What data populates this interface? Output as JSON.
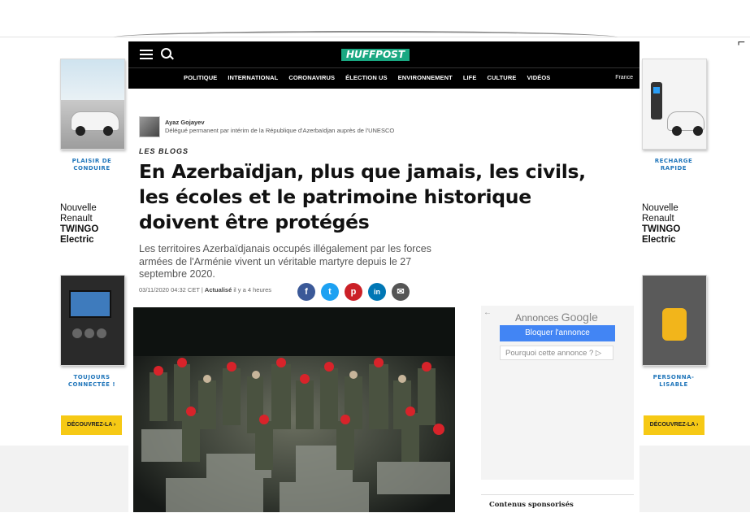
{
  "header": {
    "logo": "HUFFPOST",
    "nav": [
      "POLITIQUE",
      "INTERNATIONAL",
      "CORONAVIRUS",
      "ÉLECTION US",
      "ENVIRONNEMENT",
      "LIFE",
      "CULTURE",
      "VIDÉOS"
    ],
    "edition": "France"
  },
  "article": {
    "author_name": "Ayaz Gojayev",
    "author_role": "Délégué permanent par intérim de la République d'Azerbaïdjan auprès de l'UNESCO",
    "kicker": "LES BLOGS",
    "headline_lines": [
      "En Azerbaïdjan, plus que jamais, les civils,",
      "les écoles et le patrimoine historique",
      "doivent être protégés"
    ],
    "dek": "Les territoires Azerbaïdjanais occupés illégalement par les forces armées de l'Arménie vivent un véritable martyre depuis le 27 septembre 2020.",
    "date": "03/11/2020 04:32 CET",
    "updated_label": "Actualisé",
    "updated_rel": "il y a 4 heures"
  },
  "share": {
    "facebook": "f",
    "twitter": "t",
    "pinterest": "p",
    "linkedin": "in",
    "email": "✉"
  },
  "left_ad": {
    "caption_1": "PLAISIR DE CONDUIRE",
    "brand_1": "Nouvelle",
    "brand_2": "Renault",
    "model": "TWINGO",
    "model_2": "Electric",
    "caption_2": "TOUJOURS CONNECTÉE !",
    "cta": "DÉCOUVREZ-LA  ›"
  },
  "right_ad": {
    "caption_1": "RECHARGE RAPIDE",
    "brand_1": "Nouvelle",
    "brand_2": "Renault",
    "model": "TWINGO",
    "model_2": "Electric",
    "caption_2": "PERSONNA-LISABLE",
    "cta": "DÉCOUVREZ-LA  ›"
  },
  "google_ad": {
    "back": "←",
    "label_prefix": "Annonces",
    "label_brand": "Google",
    "block_btn": "Bloquer l'annonce",
    "why_btn": "Pourquoi cette annonce ? ▷"
  },
  "sponsored": "Contenus sponsorisés",
  "colors": {
    "huffpost_green": "#1aa882",
    "facebook": "#3b5998",
    "twitter": "#1da1f2",
    "pinterest": "#cb2027",
    "linkedin": "#0077b5",
    "email": "#555555",
    "ad_yellow": "#f6c915",
    "caption_blue": "#2277bb",
    "google_blue": "#4285f4"
  }
}
